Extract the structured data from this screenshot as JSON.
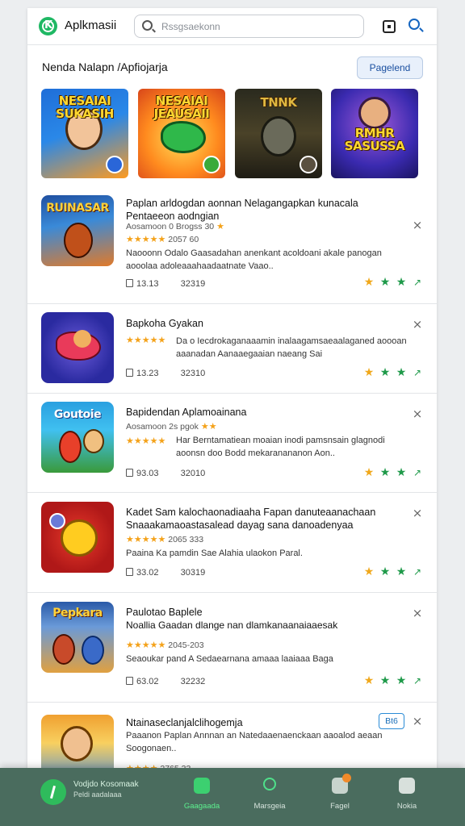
{
  "header": {
    "app_title": "Aplkmasii",
    "search_placeholder": "Rssgsaekonn"
  },
  "section": {
    "title": "Nenda Nalapn /Apfiojarja",
    "button_label": "Pagelend"
  },
  "banners": [
    {
      "title": "NESAIAI SUKASIH",
      "colors": [
        "#1a5ec8",
        "#ffb02a"
      ]
    },
    {
      "title": "NESAIAI JEAUSAII",
      "colors": [
        "#e94a1e",
        "#ffd23a"
      ]
    },
    {
      "title": "TNNK",
      "colors": [
        "#3b3a2a",
        "#b88f2a"
      ]
    },
    {
      "title": "RMHR SASUSSA",
      "colors": [
        "#3a2aa0",
        "#ff5cc8"
      ]
    }
  ],
  "items": [
    {
      "title": "Paplan arldogdan aonnan Nelagangapkan kunacala Pentaeeon aodngian",
      "meta_prefix": "Aosamoon 0 Brogss 30",
      "rating_text": "2057 60",
      "desc": "Naooonn Odalo Gaasadahan anenkant acoldoani akale panogan aooolaa adoleaaahaadaatnate Vaao..",
      "stat1": "13.13",
      "stat2": "32319",
      "thumb_title": "RUINASAR",
      "thumb_colors": [
        "#1f4fa0",
        "#e07a2a"
      ]
    },
    {
      "title": "Bapkoha Gyakan",
      "meta_prefix": "",
      "rating_text": "",
      "desc": "Da o Iecdrokaganaaamin inalaagamsaeaalaganed aoooan aaanadan Aanaaegaaian naeang Sai",
      "stat1": "13.23",
      "stat2": "32310",
      "thumb_title": "",
      "thumb_colors": [
        "#3b3fc4",
        "#e93a5a"
      ]
    },
    {
      "title": "Bapidendan Aplamoainana",
      "meta_prefix": "Aosamoon 2s pgok",
      "rating_text": "",
      "desc": "Har Berntamatiean moaian inodi pamsnsain glagnodi aoonsn doo Bodd mekaranananon Aon..",
      "stat1": "93.03",
      "stat2": "32010",
      "thumb_title": "Goutoie",
      "thumb_colors": [
        "#2a9ad8",
        "#e8402a"
      ]
    },
    {
      "title": "Kadet Sam kalochaonadiaaha Fapan danuteaanachaan Snaaakamaoastasalead dayag sana danoadenyaa",
      "meta_prefix": "",
      "rating_text": "2065 333",
      "desc": "Paaina Ka pamdin Sae Alahia ulaokon Paral.",
      "stat1": "33.02",
      "stat2": "30319",
      "thumb_title": "",
      "thumb_colors": [
        "#c01a1a",
        "#ffcc20"
      ]
    },
    {
      "title": "Paulotao Baplele",
      "subtitle": "Noallia Gaadan dlange nan dlamkanaanaiaaesak",
      "meta_prefix": "",
      "rating_text": "2045-203",
      "desc": "Seaoukar pand A Sedaearnana amaaa laaiaaa Baga",
      "stat1": "63.02",
      "stat2": "32232",
      "thumb_title": "Pepkara",
      "thumb_colors": [
        "#2a5aa8",
        "#e0a040"
      ]
    },
    {
      "title": "Ntainaseclanjalclihogemja",
      "meta_prefix": "",
      "rating_text": "2765 33",
      "desc": "Paaanon Paplan Annnan an Natedaaenaenckaan aaoalod aeaan Soogonaen..",
      "badge": "Bt6",
      "thumb_title": "",
      "thumb_colors": [
        "#f0a030",
        "#4a8ad8"
      ]
    }
  ],
  "bottom_nav": {
    "user_name": "Vodjdo Kosomaak",
    "user_sub": "Peldi aadalaaa",
    "tabs": [
      {
        "label": "Gaagaada",
        "icon": "grid-icon",
        "active": true
      },
      {
        "label": "Marsgeia",
        "icon": "search-icon",
        "active": false
      },
      {
        "label": "Fagel",
        "icon": "bag-icon",
        "active": false
      },
      {
        "label": "Nokia",
        "icon": "list-icon",
        "active": false
      }
    ]
  },
  "colors": {
    "accent": "#1fb864",
    "nav_bg": "#4a6c5e",
    "star": "#f4a21a"
  }
}
